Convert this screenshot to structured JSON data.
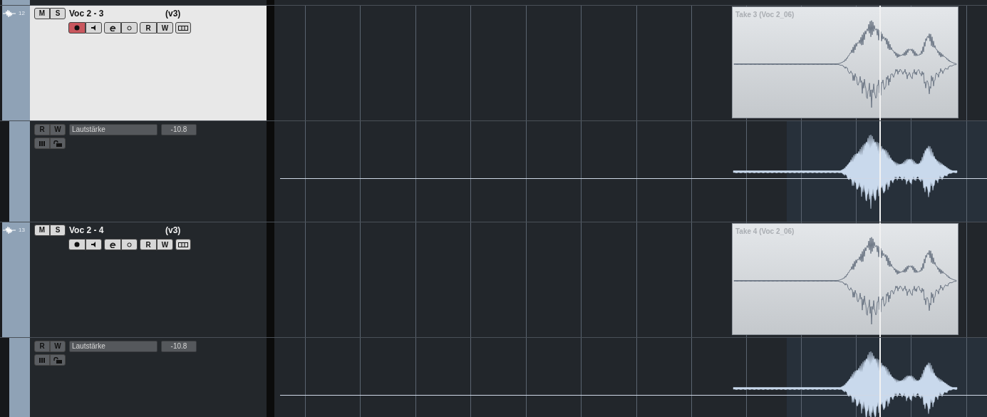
{
  "tracks": [
    {
      "number": "12",
      "name": "Voc 2 - 3",
      "version": "(v3)",
      "selected": true,
      "record_enabled": true,
      "mute": "M",
      "solo": "S",
      "read": "R",
      "write": "W",
      "event": {
        "title": "Take 3 (Voc 2_06)"
      },
      "automation": {
        "read": "R",
        "write": "W",
        "parameter": "Lautstärke",
        "value": "-10.8"
      }
    },
    {
      "number": "13",
      "name": "Voc 2 - 4",
      "version": "(v3)",
      "selected": false,
      "record_enabled": false,
      "mute": "M",
      "solo": "S",
      "read": "R",
      "write": "W",
      "event": {
        "title": "Take 4 (Voc 2_06)"
      },
      "automation": {
        "read": "R",
        "write": "W",
        "parameter": "Lautstärke",
        "value": "-10.8"
      }
    }
  ]
}
